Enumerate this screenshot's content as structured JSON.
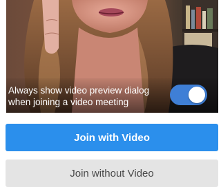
{
  "preview": {
    "toggle_label": "Always show video preview dialog when joining a video meeting",
    "toggle_on": true,
    "toggle_color": "#3f7fd6"
  },
  "actions": {
    "join_with_video": "Join with Video",
    "join_without_video": "Join without Video",
    "primary_color": "#2b8fec",
    "secondary_color": "#e4e4e4"
  }
}
